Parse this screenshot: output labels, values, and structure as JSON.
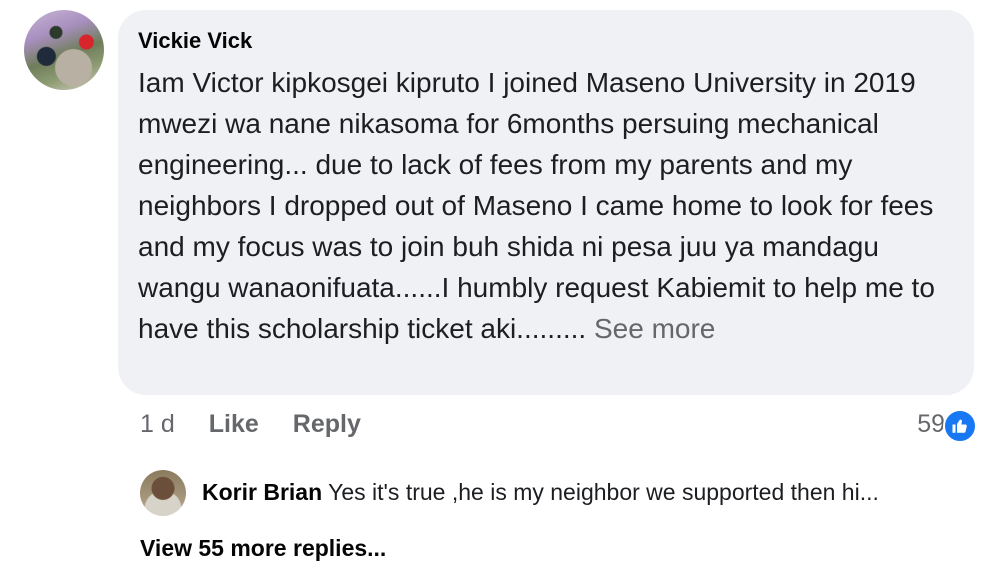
{
  "comment": {
    "author": "Vickie Vick",
    "text": "Iam Victor kipkosgei kipruto I joined Maseno University in 2019 mwezi wa nane nikasoma for 6months persuing mechanical engineering... due to lack of fees from my parents and my neighbors I dropped out of Maseno I came home to look for fees and my focus was to join buh shida ni pesa juu ya mandagu wangu wanaonifuata......I humbly request Kabiemit to help me to have this scholarship ticket aki.........",
    "see_more": "See more",
    "time": "1 d",
    "like_label": "Like",
    "reply_label": "Reply",
    "reaction_count": "59",
    "reaction_icon": "like-thumbs-up-icon"
  },
  "reply": {
    "author": "Korir Brian",
    "text": "Yes it's true ,he is my neighbor we supported then hi..."
  },
  "view_more_replies": "View 55 more replies...",
  "colors": {
    "bubble": "#eff1f5",
    "secondary_text": "#65676b",
    "like_blue": "#1877f2"
  }
}
